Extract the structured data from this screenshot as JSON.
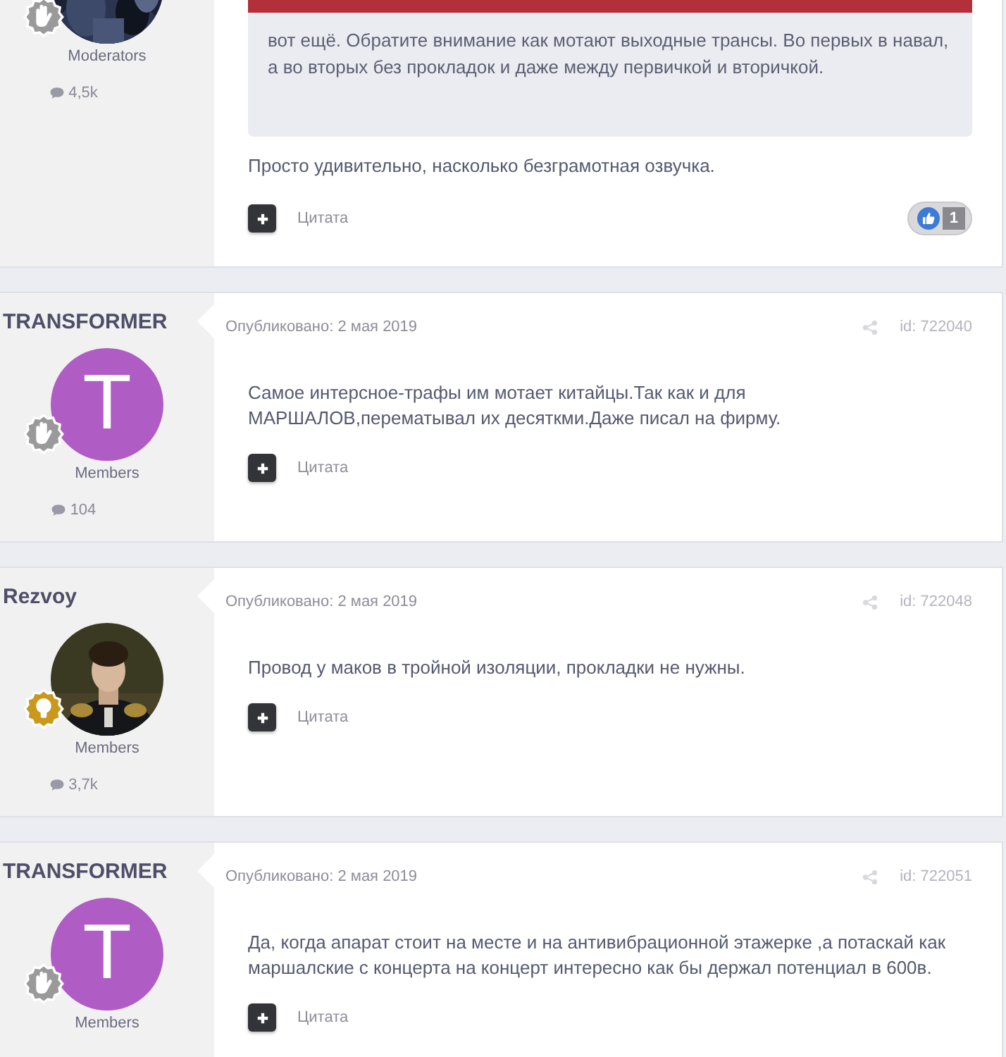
{
  "posts": [
    {
      "badge": {
        "kind": "hand"
      },
      "group": "Moderators",
      "post_count": "4,5k",
      "quote": {
        "text": "вот ещё. Обратите внимание как мотают выходные трансы. Во первых в навал, а во вторых без прокладок и даже между первичкой и вторичкой."
      },
      "paragraphs": [
        "Просто удивительно, насколько безграмотная озвучка."
      ],
      "quote_button": "Цитата",
      "reaction": {
        "count": "1"
      }
    },
    {
      "author": "TRANSFORMER",
      "avatar": {
        "kind": "letter",
        "letter": "T",
        "color": "#b05cc5"
      },
      "badge": {
        "kind": "hand"
      },
      "group": "Members",
      "post_count": "104",
      "date": "Опубликовано: 2 мая 2019",
      "post_id": "id: 722040",
      "paragraphs": [
        "Самое интерсное-трафы им мотает китайцы.Так как и для МАРШАЛОВ,перематывал их десяткми.Даже писал на фирму."
      ],
      "quote_button": "Цитата"
    },
    {
      "author": "Rezvoy",
      "badge": {
        "kind": "bulb"
      },
      "group": "Members",
      "post_count": "3,7k",
      "date": "Опубликовано: 2 мая 2019",
      "post_id": "id: 722048",
      "paragraphs": [
        "Провод у маков в тройной изоляции, прокладки не нужны."
      ],
      "quote_button": "Цитата"
    },
    {
      "author": "TRANSFORMER",
      "avatar": {
        "kind": "letter",
        "letter": "T",
        "color": "#b05cc5"
      },
      "badge": {
        "kind": "hand"
      },
      "group": "Members",
      "date": "Опубликовано: 2 мая 2019",
      "post_id": "id: 722051",
      "paragraphs": [
        "Да, когда апарат стоит на месте и на антивибрационной этажерке ,а потаскай как маршалские с концерта на концерт интересно как бы держал потенциал в 600в."
      ],
      "quote_button": "Цитата"
    }
  ]
}
